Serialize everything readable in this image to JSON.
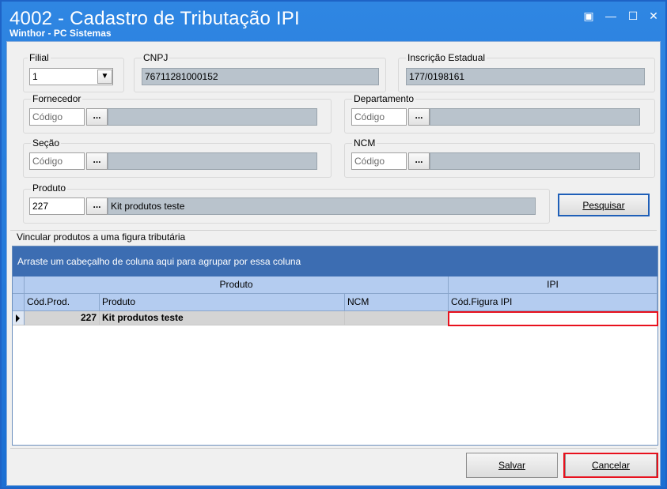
{
  "window": {
    "title": "4002 - Cadastro de Tributação IPI",
    "subtitle": "Winthor - PC Sistemas",
    "controls": {
      "restore": "▣",
      "minimize": "—",
      "maximize": "☐",
      "close": "✕"
    }
  },
  "filters": {
    "filial": {
      "label": "Filial",
      "value": "1",
      "dropdown_icon": "chevron-down"
    },
    "cnpj": {
      "label": "CNPJ",
      "value": "76711281000152"
    },
    "inscricao": {
      "label": "Inscrição Estadual",
      "value": "177/0198161"
    },
    "fornecedor": {
      "label": "Fornecedor",
      "placeholder": "Código",
      "button": "...",
      "description": ""
    },
    "departamento": {
      "label": "Departamento",
      "placeholder": "Código",
      "button": "...",
      "description": ""
    },
    "secao": {
      "label": "Seção",
      "placeholder": "Código",
      "button": "...",
      "description": ""
    },
    "ncm": {
      "label": "NCM",
      "placeholder": "Código",
      "button": "...",
      "description": ""
    },
    "produto": {
      "label": "Produto",
      "value": "227",
      "button": "...",
      "description": "Kit produtos teste"
    },
    "pesquisar_label": "Pesquisar"
  },
  "grid": {
    "section_label": "Vincular produtos a uma figura tributária",
    "group_panel_text": "Arraste um cabeçalho de coluna aqui para agrupar por essa coluna",
    "bands": [
      "Produto",
      "IPI"
    ],
    "columns": [
      "Cód.Prod.",
      "Produto",
      "NCM",
      "Cód.Figura IPI"
    ],
    "rows": [
      {
        "cod_prod": "227",
        "produto": "Kit produtos teste",
        "ncm": "",
        "cod_figura_ipi": ""
      }
    ]
  },
  "footer": {
    "salvar_label": "Salvar",
    "cancelar_label": "Cancelar"
  },
  "highlight_color": "#e8111d"
}
